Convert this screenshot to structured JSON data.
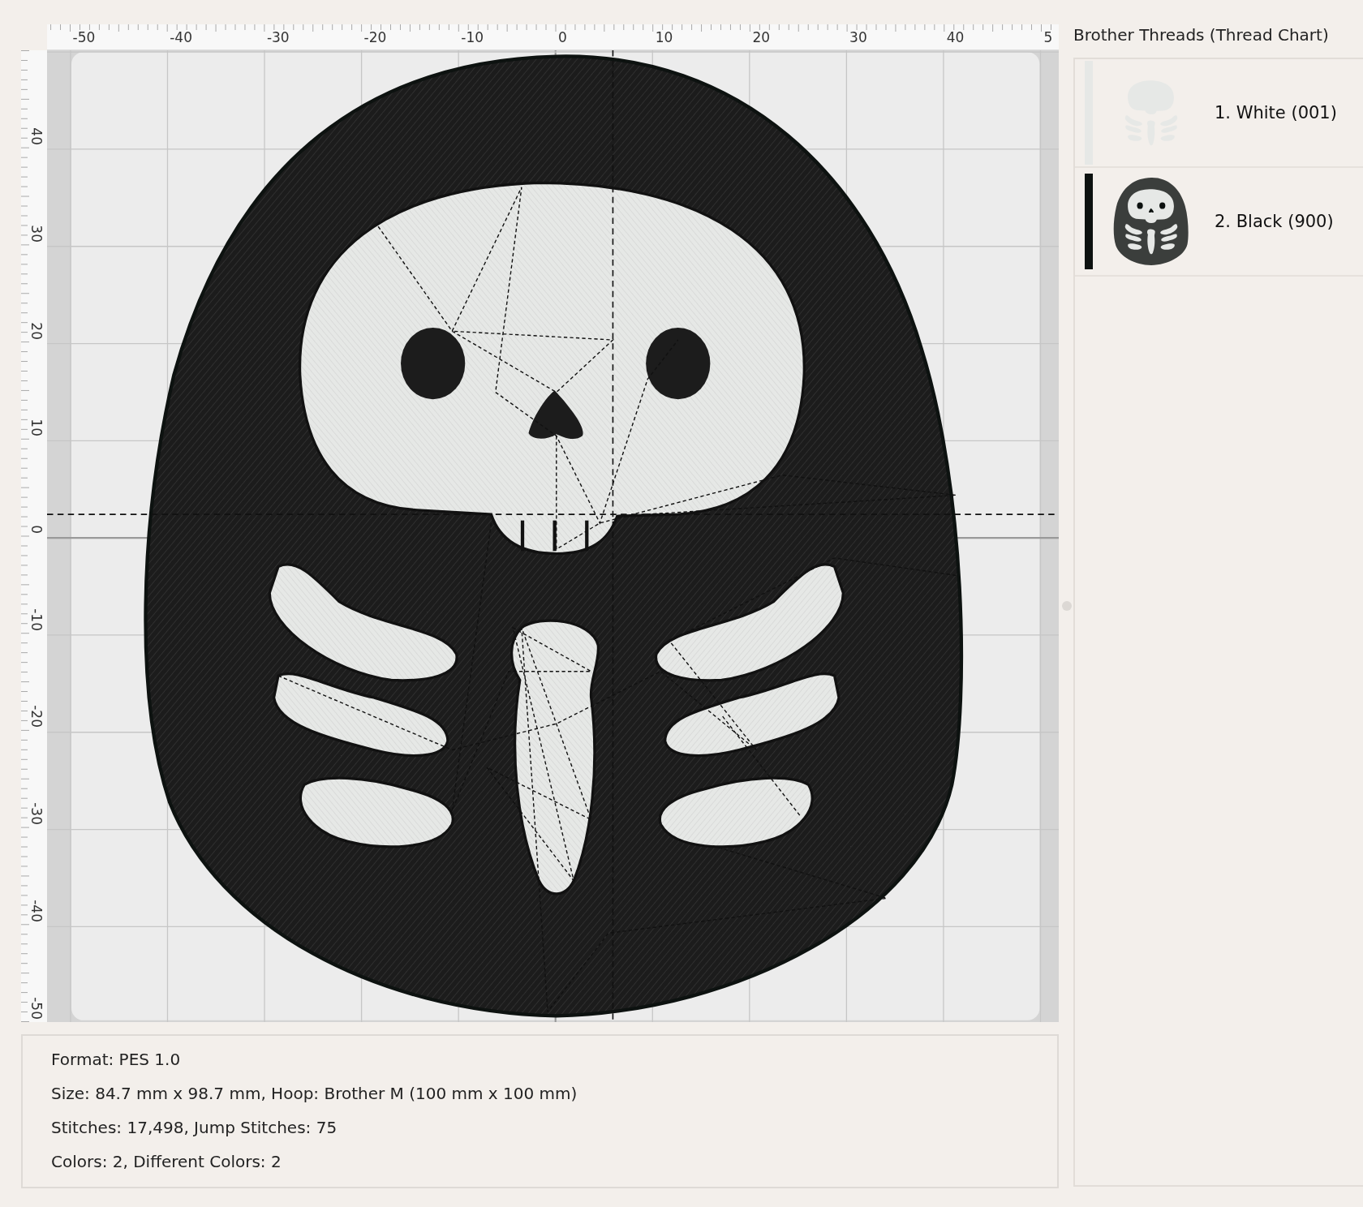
{
  "ruler_top": {
    "labels": [
      "-50",
      "-40",
      "-30",
      "-20",
      "-10",
      "0",
      "10",
      "20",
      "30",
      "40",
      "5"
    ]
  },
  "ruler_left": {
    "labels": [
      "40",
      "30",
      "20",
      "10",
      "0",
      "-10",
      "-20",
      "-30",
      "-40",
      "-50"
    ]
  },
  "info": [
    "Format: PES 1.0",
    "Size: 84.7 mm x 98.7 mm, Hoop: Brother M (100 mm x 100 mm)",
    "Stitches: 17,498, Jump Stitches: 75",
    "Colors: 2, Different Colors: 2"
  ],
  "thread_chart": {
    "title": "Brother Threads (Thread Chart)",
    "threads": [
      {
        "label": "1. White (001)",
        "color": "#e6e8e6",
        "selected": false
      },
      {
        "label": "2. Black (900)",
        "color": "#0d1210",
        "selected": true
      }
    ]
  }
}
